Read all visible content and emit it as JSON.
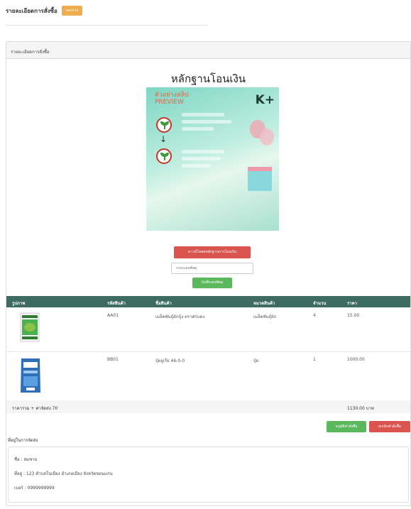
{
  "header": {
    "title": "รายละเอียดการสั่งซื้อ",
    "status_badge": "รอตรวจ"
  },
  "panel": {
    "heading": "รายละเอียดการสั่งซื้อ"
  },
  "proof": {
    "title": "หลักฐานโอนเงิน",
    "slip_label_1": "ตัวอย่างสลิป",
    "slip_label_2": "PREVIEW",
    "slip_logo": "K+"
  },
  "actions": {
    "download_label": "ดาวน์โหลดหลักฐานการโอนเงิน",
    "tracking_placeholder": "กรอกเลขพัสดุ",
    "save_label": "บันทึกเลขพัสดุ",
    "approve_label": "อนุมัติคำสั่งซื้อ",
    "cancel_label": "ยกเลิกคำสั่งซื้อ"
  },
  "table": {
    "headers": [
      "รูปภาพ",
      "รหัสสินค้า",
      "ชื่อสินค้า",
      "หมวดสินค้า",
      "จำนวน",
      "ราคา"
    ],
    "rows": [
      {
        "code": "AA01",
        "name": "เมล็ดพันธุ์ผักบุ้ง ตราศรแดง",
        "category": "เมล็ดพันธุ์ผัก",
        "qty": "4",
        "price": "15.00",
        "image": "seed-packet-icon"
      },
      {
        "code": "BB01",
        "name": "ปุ๋ยยูเรีย 46-0-0",
        "category": "ปุ๋ย",
        "qty": "1",
        "price": "1000.00",
        "image": "fertilizer-bag-icon"
      }
    ],
    "total_label": "ราคารวม + ค่าจัดส่ง 70",
    "total_value": "1130.00 บาท"
  },
  "shipping": {
    "title": "ที่อยู่ในการจัดส่ง",
    "name": "ชื่อ : สมชาย",
    "address": "ที่อยู่ : 123 ตำบลในเมือง อำเภอเมือง จังหวัดขอนแก่น",
    "phone": "เบอร์ : 0999999999"
  },
  "colors": {
    "primary_green": "#5cb85c",
    "danger_red": "#d9534f",
    "table_header": "#3d6b61",
    "badge_orange": "#f0ad4e"
  }
}
